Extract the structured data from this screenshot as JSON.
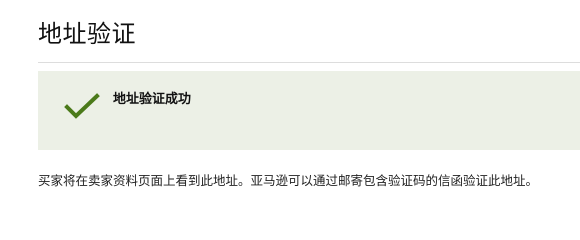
{
  "header": {
    "title": "地址验证"
  },
  "success_banner": {
    "message": "地址验证成功",
    "icon": "checkmark-icon",
    "background_color": "#ecf0e6",
    "icon_color": "#4b7a1a"
  },
  "info": {
    "text": "买家将在卖家资料页面上看到此地址。亚马逊可以通过邮寄包含验证码的信函验证此地址。"
  }
}
